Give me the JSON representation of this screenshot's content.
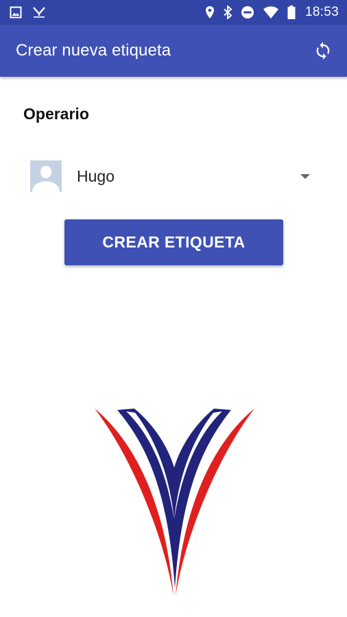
{
  "status_bar": {
    "time": "18:53",
    "left_icons": [
      "image-icon",
      "app-notification-icon"
    ],
    "right_icons": [
      "location-icon",
      "bluetooth-icon",
      "do-not-disturb-icon",
      "wifi-icon",
      "battery-icon"
    ]
  },
  "app_bar": {
    "title": "Crear nueva etiqueta",
    "action_icon": "refresh-icon",
    "color": "#3f51b5"
  },
  "form": {
    "operator_label": "Operario",
    "operator_selected": "Hugo",
    "create_button_label": "CREAR ETIQUETA"
  },
  "logo": {
    "colors": [
      "#e02020",
      "#22237a",
      "#ffffff"
    ]
  }
}
